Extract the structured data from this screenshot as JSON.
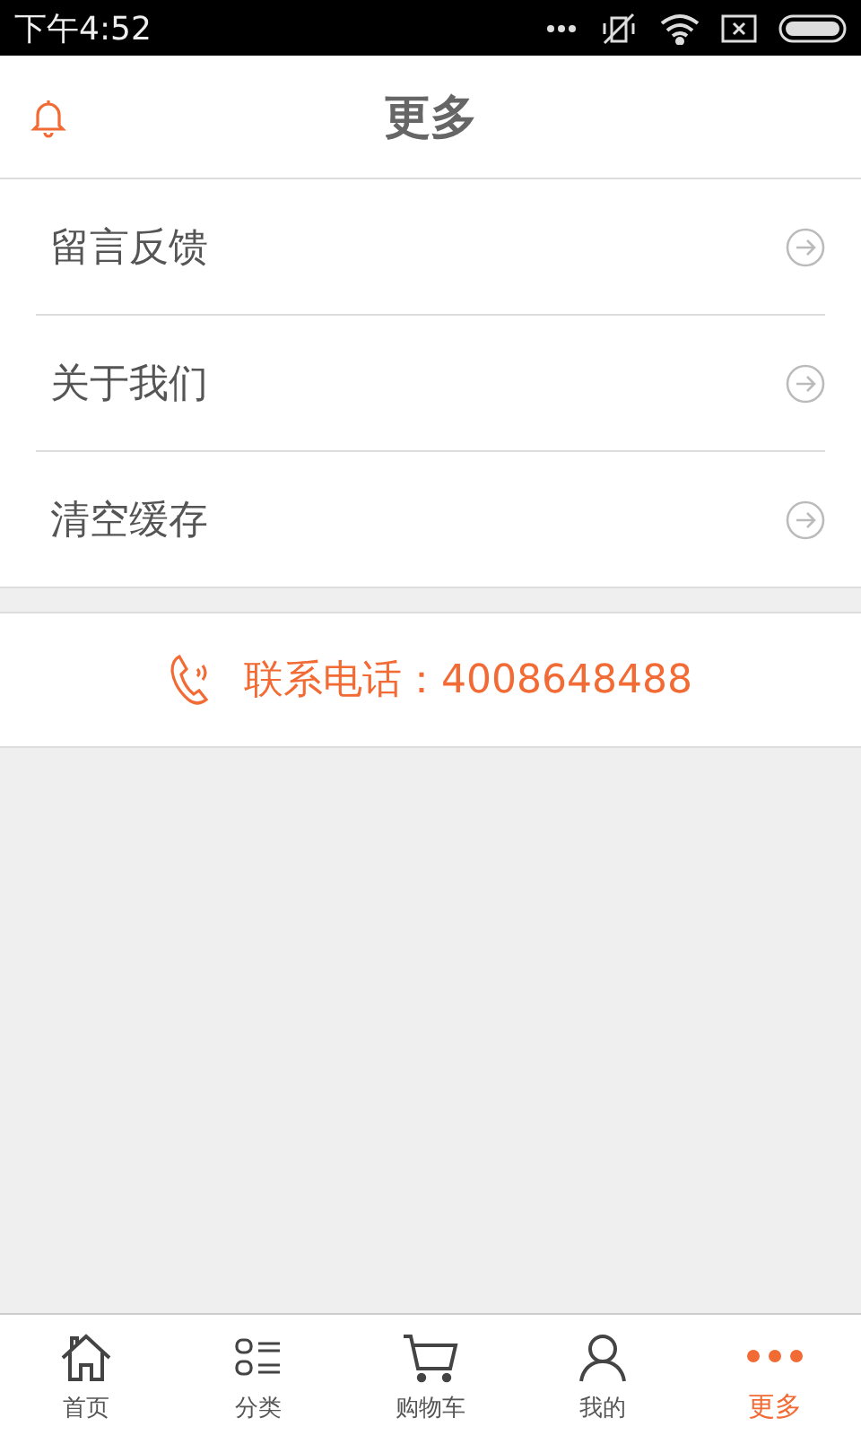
{
  "status_bar": {
    "time": "下午4:52"
  },
  "header": {
    "title": "更多"
  },
  "menu": [
    {
      "label": "留言反馈"
    },
    {
      "label": "关于我们"
    },
    {
      "label": "清空缓存"
    }
  ],
  "contact": {
    "text": "联系电话：4008648488"
  },
  "tabs": [
    {
      "kind": "home",
      "label": "首页",
      "selected": false
    },
    {
      "kind": "category",
      "label": "分类",
      "selected": false
    },
    {
      "kind": "cart",
      "label": "购物车",
      "selected": false
    },
    {
      "kind": "user",
      "label": "我的",
      "selected": false
    },
    {
      "kind": "more",
      "label": "更多",
      "selected": true
    }
  ]
}
